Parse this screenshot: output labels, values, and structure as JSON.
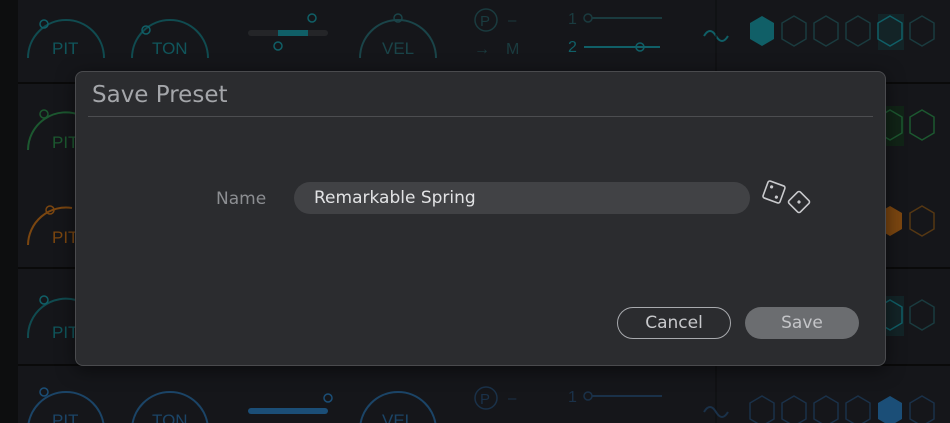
{
  "background": {
    "row1_labels": [
      "PIT",
      "TON",
      "VEL"
    ],
    "row2_labels": [
      "PIT"
    ],
    "row3_labels": [
      "PIT"
    ],
    "row4_labels": [
      "PIT"
    ],
    "row5_labels": [
      "PIT",
      "TON",
      "VEL"
    ],
    "p_label": "P",
    "m_label": "M",
    "dash": "–",
    "lane1": "1",
    "lane2": "2",
    "accent_teal": "#1a9aa6",
    "accent_green": "#2e8f4e",
    "accent_orange": "#c7711a",
    "accent_blue": "#2d7fc0"
  },
  "dialog": {
    "title": "Save Preset",
    "name_label": "Name",
    "name_value": "Remarkable Spring",
    "randomize_icon": "dice-icon",
    "cancel_label": "Cancel",
    "save_label": "Save"
  }
}
